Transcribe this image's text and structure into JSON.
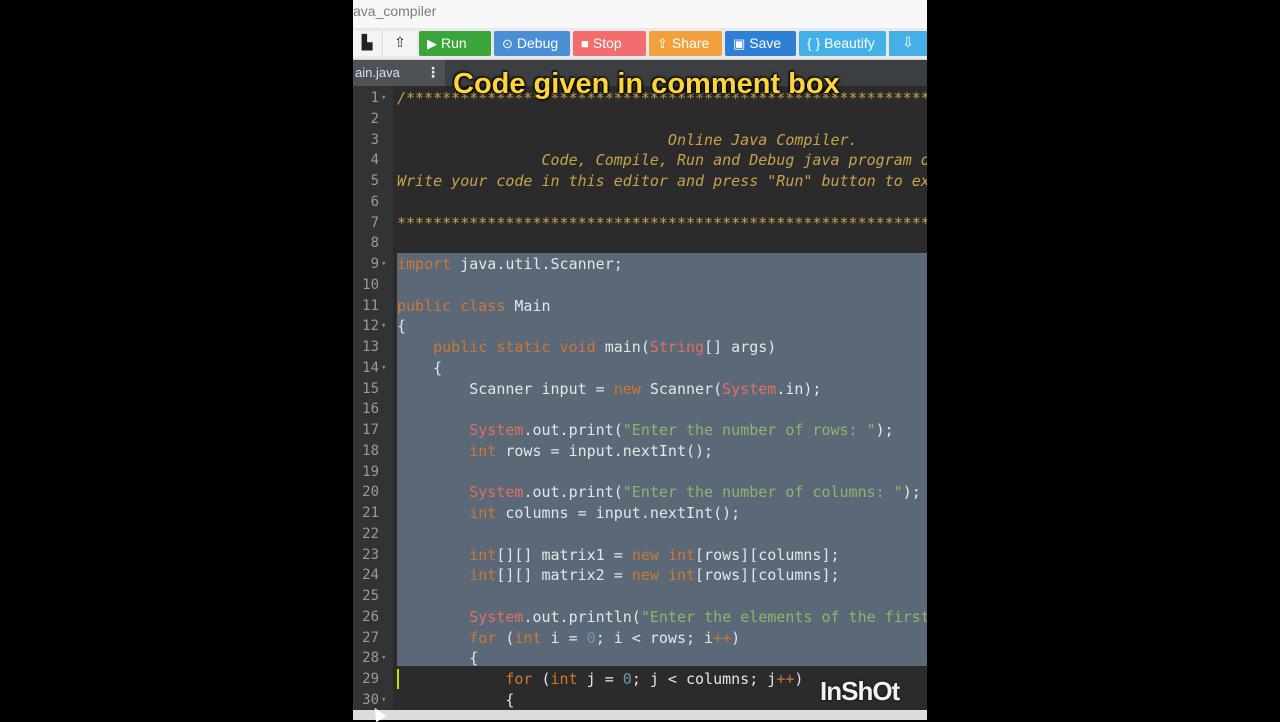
{
  "window": {
    "title": "ava_compiler"
  },
  "toolbar": {
    "buttons": [
      {
        "label": "Run",
        "icon": "play-icon",
        "glyph": "▶",
        "color": "#3aa63a"
      },
      {
        "label": "Debug",
        "icon": "debug-icon",
        "glyph": "⊙",
        "color": "#4a8fd6"
      },
      {
        "label": "Stop",
        "icon": "stop-icon",
        "glyph": "■",
        "color": "#f26d6d"
      },
      {
        "label": "Share",
        "icon": "share-icon",
        "glyph": "⇪",
        "color": "#f2a03c"
      },
      {
        "label": "Save",
        "icon": "save-icon",
        "glyph": "▣",
        "color": "#2f7fd4"
      },
      {
        "label": "{ } Beautify",
        "icon": "beautify-icon",
        "glyph": "",
        "color": "#45b0e8"
      }
    ],
    "left_icons": [
      "file-icon",
      "upload-icon"
    ],
    "right_icon": "download-icon"
  },
  "tab": {
    "label": "ain.java",
    "menu_glyph": "⋮"
  },
  "overlay": {
    "title": "Code given in comment box",
    "watermark": "InShOt"
  },
  "editor": {
    "lines": [
      {
        "n": "1",
        "fold": "▾",
        "text": "/********************************************************************"
      },
      {
        "n": "2",
        "fold": "",
        "text": ""
      },
      {
        "n": "3",
        "fold": "",
        "text": "                              Online Java Compiler."
      },
      {
        "n": "4",
        "fold": "",
        "text": "                Code, Compile, Run and Debug java program online."
      },
      {
        "n": "5",
        "fold": "",
        "text": "Write your code in this editor and press \"Run\" button to execute it."
      },
      {
        "n": "6",
        "fold": "",
        "text": ""
      },
      {
        "n": "7",
        "fold": "",
        "text": "*********************************************************************"
      },
      {
        "n": "8",
        "fold": "",
        "text": ""
      },
      {
        "n": "9",
        "fold": "▾",
        "text": "import java.util.Scanner;"
      },
      {
        "n": "10",
        "fold": "",
        "text": ""
      },
      {
        "n": "11",
        "fold": "",
        "text": "public class Main"
      },
      {
        "n": "12",
        "fold": "▾",
        "text": "{"
      },
      {
        "n": "13",
        "fold": "",
        "text": "    public static void main(String[] args)"
      },
      {
        "n": "14",
        "fold": "▾",
        "text": "    {"
      },
      {
        "n": "15",
        "fold": "",
        "text": "        Scanner input = new Scanner(System.in);"
      },
      {
        "n": "16",
        "fold": "",
        "text": ""
      },
      {
        "n": "17",
        "fold": "",
        "text": "        System.out.print(\"Enter the number of rows: \");"
      },
      {
        "n": "18",
        "fold": "",
        "text": "        int rows = input.nextInt();"
      },
      {
        "n": "19",
        "fold": "",
        "text": ""
      },
      {
        "n": "20",
        "fold": "",
        "text": "        System.out.print(\"Enter the number of columns: \");"
      },
      {
        "n": "21",
        "fold": "",
        "text": "        int columns = input.nextInt();"
      },
      {
        "n": "22",
        "fold": "",
        "text": ""
      },
      {
        "n": "23",
        "fold": "",
        "text": "        int[][] matrix1 = new int[rows][columns];"
      },
      {
        "n": "24",
        "fold": "",
        "text": "        int[][] matrix2 = new int[rows][columns];"
      },
      {
        "n": "25",
        "fold": "",
        "text": ""
      },
      {
        "n": "26",
        "fold": "",
        "text": "        System.out.println(\"Enter the elements of the first matrix:\");"
      },
      {
        "n": "27",
        "fold": "",
        "text": "        for (int i = 0; i < rows; i++)"
      },
      {
        "n": "28",
        "fold": "▾",
        "text": "        {"
      },
      {
        "n": "29",
        "fold": "",
        "text": "            for (int j = 0; j < columns; j++)"
      },
      {
        "n": "30",
        "fold": "▾",
        "text": "            {"
      }
    ]
  }
}
